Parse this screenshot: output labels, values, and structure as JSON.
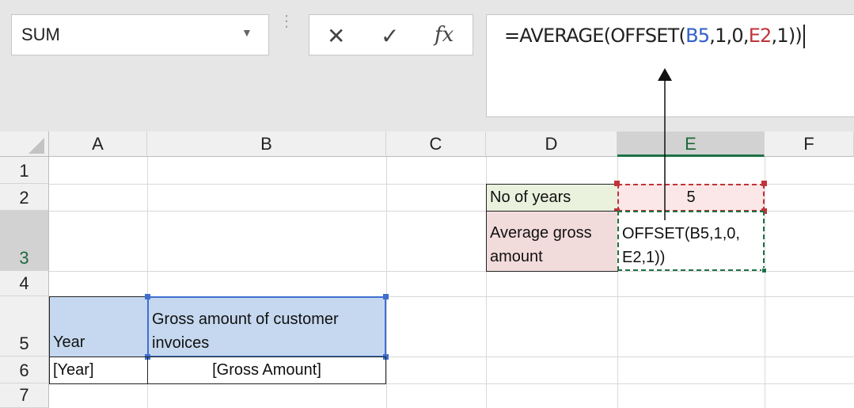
{
  "app": {
    "name_box": {
      "value": "SUM"
    },
    "formula_bar": {
      "prefix": "=AVERAGE(OFFSET(",
      "ref1": "B5",
      "mid": ",1,0,",
      "ref2": "E2",
      "suffix": ",1))"
    },
    "buttons": {
      "cancel": "✕",
      "enter": "✓",
      "insert_function": "fx"
    }
  },
  "sheet": {
    "columns": [
      "A",
      "B",
      "C",
      "D",
      "E",
      "F"
    ],
    "rows": [
      "1",
      "2",
      "3",
      "4",
      "5",
      "6",
      "7"
    ],
    "selected_column": "E",
    "selected_row": "3",
    "cells": {
      "D2": "No of years",
      "E2": "5",
      "D3_line1": "Average gross",
      "D3_line2": "amount",
      "E3_line1": "OFFSET(B5,1,0,",
      "E3_line2": "E2,1))",
      "A5": "Year",
      "B5_line1": "Gross amount of customer",
      "B5_line2": "invoices",
      "A6": "[Year]",
      "B6": "[Gross Amount]"
    }
  },
  "colors": {
    "header_fill": "#c5d8ef",
    "no_years_fill": "#eaf1dd",
    "avg_label_fill": "#f2dcdb",
    "e2_fill": "#fbe7e7",
    "e2_border": "#c0343a",
    "b5_border": "#3f6fce",
    "active_border": "#1e7145"
  }
}
